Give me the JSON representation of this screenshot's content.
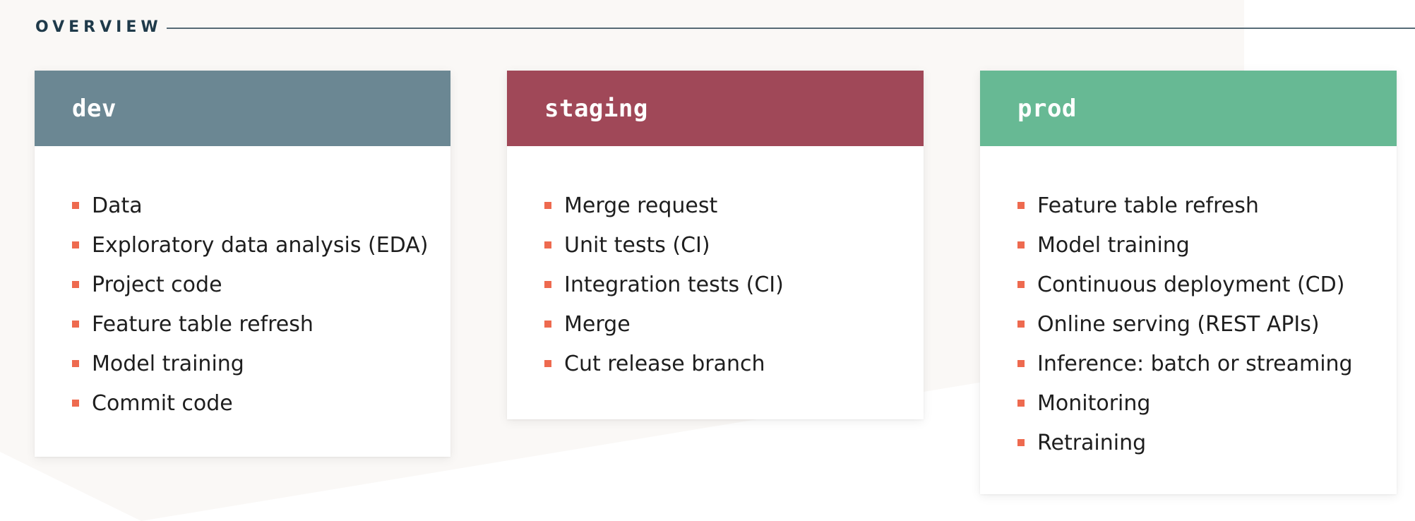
{
  "header": {
    "label": "OVERVIEW"
  },
  "colors": {
    "dev": "#6b8793",
    "staging": "#a04858",
    "prod": "#67b994",
    "bullet": "#ee6a4f",
    "arrow": "#1f3a4a",
    "background_shape": "#faf8f6"
  },
  "cards": {
    "dev": {
      "title": "dev",
      "items": [
        "Data",
        "Exploratory data analysis (EDA)",
        "Project code",
        "Feature table refresh",
        "Model training",
        "Commit code"
      ]
    },
    "staging": {
      "title": "staging",
      "items": [
        "Merge request",
        "Unit tests (CI)",
        "Integration tests (CI)",
        "Merge",
        "Cut release branch"
      ]
    },
    "prod": {
      "title": "prod",
      "items": [
        "Feature table refresh",
        "Model training",
        "Continuous deployment (CD)",
        "Online serving (REST APIs)",
        "Inference: batch or streaming",
        "Monitoring",
        "Retraining"
      ]
    }
  }
}
